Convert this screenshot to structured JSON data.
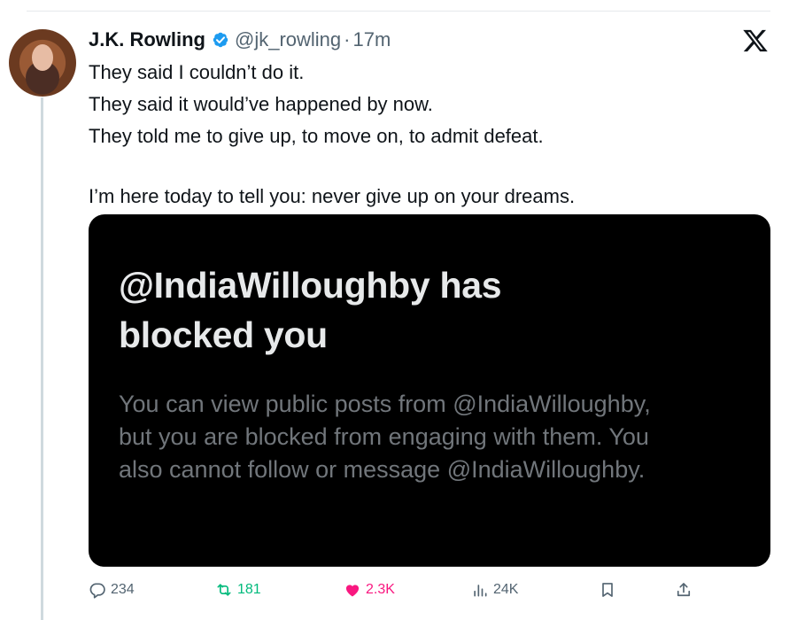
{
  "tweet": {
    "author_name": "J.K. Rowling",
    "handle": "@jk_rowling",
    "separator": "·",
    "time": "17m",
    "lines": [
      "They said I couldn’t do it.",
      "They said it would’ve  happened by now.",
      "They told me to give up, to move on, to admit defeat.",
      "I’m here today to tell you: never give up on your dreams."
    ]
  },
  "card": {
    "title_line1": "@IndiaWilloughby has",
    "title_line2": "blocked you",
    "desc_line1": "You can view public posts from @IndiaWilloughby,",
    "desc_line2": "but you are blocked from engaging with them. You",
    "desc_line3": "also cannot follow or message @IndiaWilloughby."
  },
  "actions": {
    "replies": "234",
    "reposts": "181",
    "likes": "2.3K",
    "views": "24K"
  },
  "icons": {
    "verified": "verified-badge-icon",
    "x_logo": "x-logo-icon",
    "reply": "reply-icon",
    "repost": "repost-icon",
    "like": "heart-icon",
    "views": "views-icon",
    "bookmark": "bookmark-icon",
    "share": "share-icon"
  },
  "colors": {
    "verified": "#1d9bf0",
    "repost_active": "#00ba7c",
    "like_active": "#f91880",
    "muted": "#536471",
    "card_bg": "#000000"
  }
}
